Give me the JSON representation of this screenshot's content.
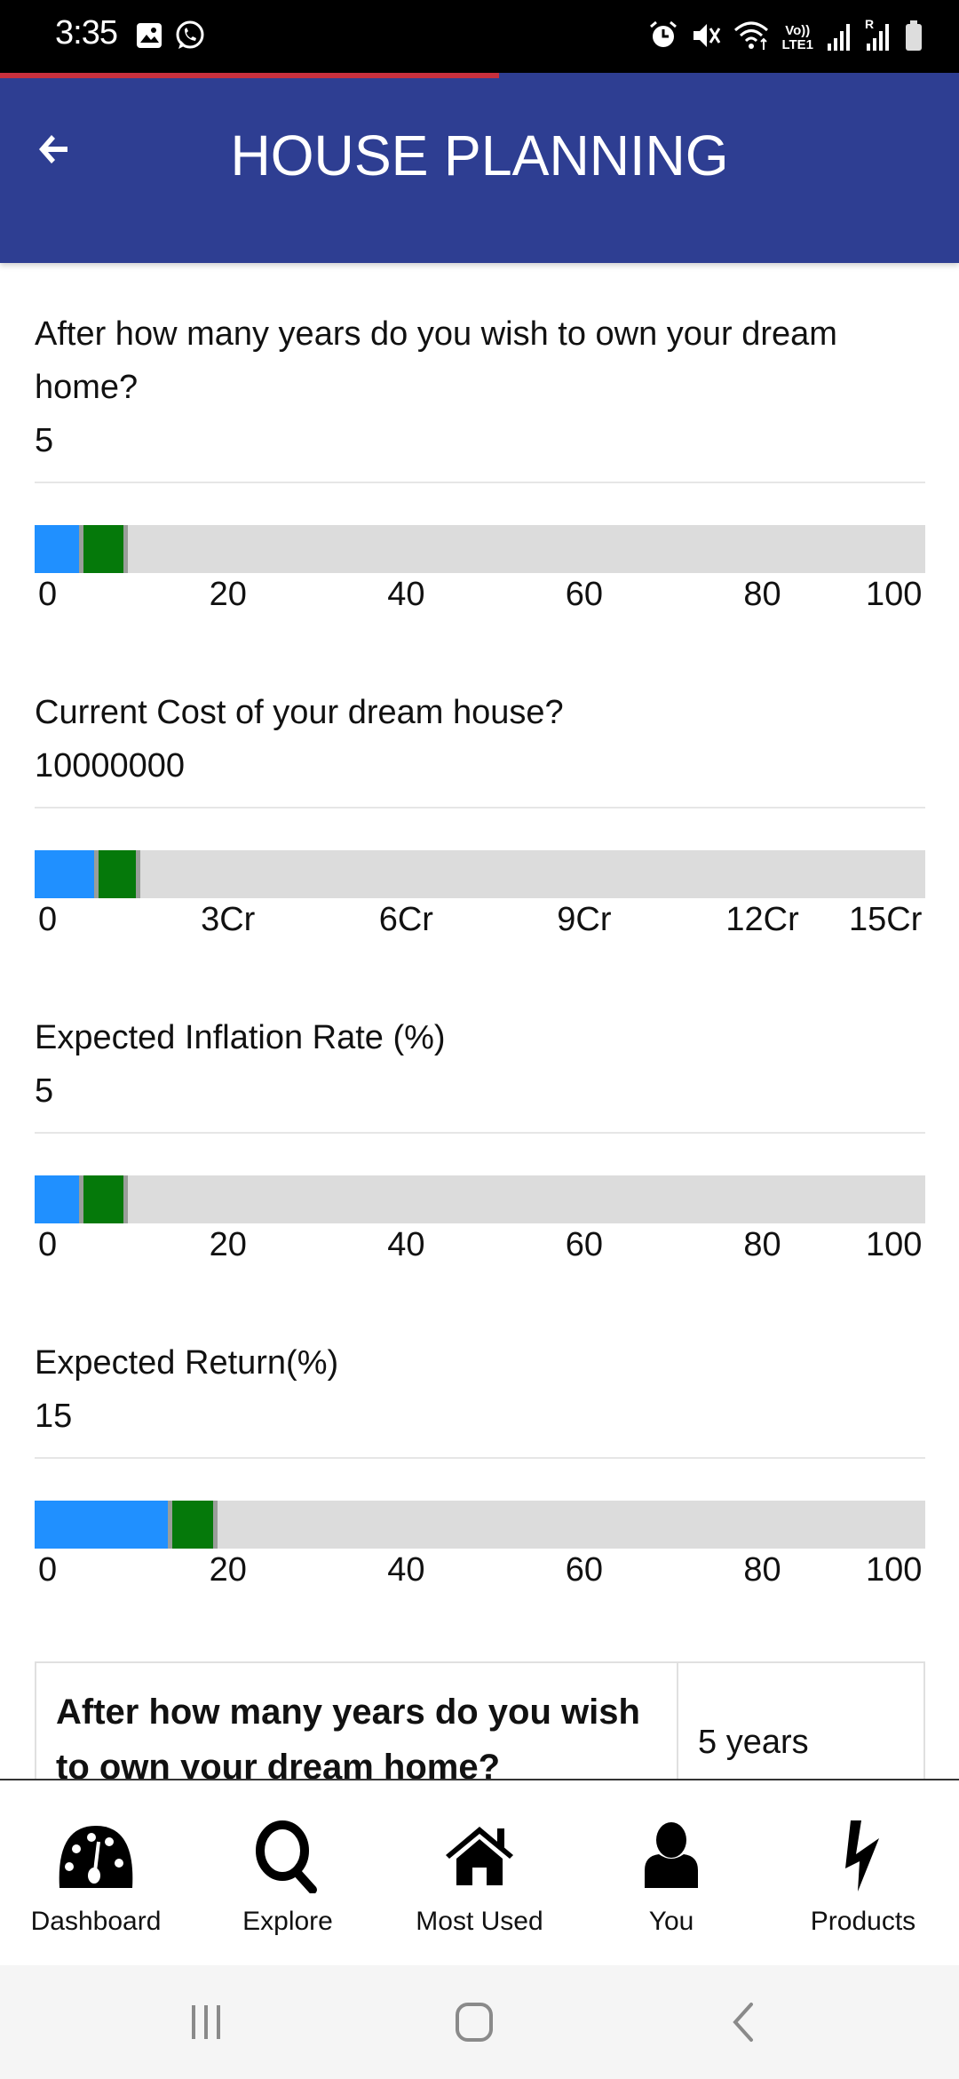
{
  "status_bar": {
    "time": "3:35",
    "left_icons": [
      "gallery-icon",
      "whatsapp-icon"
    ],
    "right_icons": [
      "alarm-icon",
      "mute-icon",
      "wifi-icon",
      "volte-lte1-icon",
      "signal-icon",
      "roaming-signal-icon",
      "battery-icon"
    ],
    "volte_label": "Vo))",
    "lte_label": "LTE1",
    "roaming_label": "R"
  },
  "page_load_progress": 0.52,
  "header": {
    "title": "HOUSE PLANNING",
    "back_icon": "arrow-left-icon"
  },
  "colors": {
    "header_bg": "#2E3E92",
    "progress_red": "#C8303E",
    "slider_blue": "#2090FF",
    "slider_green": "#05790A",
    "slider_track": "#DCDCDC"
  },
  "questions": [
    {
      "label": "After how many years do you wish to own your dream home?",
      "value": "5",
      "slider": {
        "min": 0,
        "max": 100,
        "blue_end": 5,
        "green_end": 10,
        "ticks": [
          "0",
          "20",
          "40",
          "60",
          "80",
          "100"
        ]
      }
    },
    {
      "label": "Current Cost of your dream house?",
      "value": "10000000",
      "slider": {
        "min": 0,
        "max": 150000000,
        "blue_end": 10000000,
        "green_end": 17000000,
        "ticks": [
          "0",
          "3Cr",
          "6Cr",
          "9Cr",
          "12Cr",
          "15Cr"
        ]
      }
    },
    {
      "label": "Expected Inflation Rate (%)",
      "value": "5",
      "slider": {
        "min": 0,
        "max": 100,
        "blue_end": 5,
        "green_end": 10,
        "ticks": [
          "0",
          "20",
          "40",
          "60",
          "80",
          "100"
        ]
      }
    },
    {
      "label": "Expected Return(%)",
      "value": "15",
      "slider": {
        "min": 0,
        "max": 100,
        "blue_end": 15,
        "green_end": 20,
        "ticks": [
          "0",
          "20",
          "40",
          "60",
          "80",
          "100"
        ]
      }
    }
  ],
  "summary_table": {
    "rows": [
      {
        "question": "After how many years do you wish to own your dream home?",
        "answer": "5 years"
      }
    ]
  },
  "bottom_nav": {
    "items": [
      {
        "label": "Dashboard",
        "icon": "dashboard-gauge-icon"
      },
      {
        "label": "Explore",
        "icon": "search-icon"
      },
      {
        "label": "Most Used",
        "icon": "home-icon"
      },
      {
        "label": "You",
        "icon": "user-icon"
      },
      {
        "label": "Products",
        "icon": "lightning-icon"
      }
    ]
  },
  "system_nav": {
    "buttons": [
      "recent-apps-icon",
      "home-button-icon",
      "back-icon"
    ]
  }
}
